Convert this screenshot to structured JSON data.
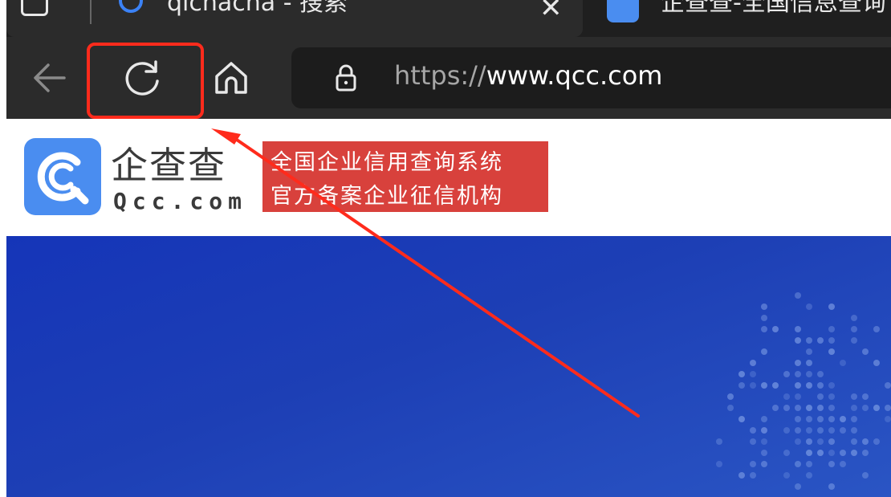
{
  "browser": {
    "active_tab_title": "qichacha - 搜索",
    "second_tab_title": "企查查-全国信息查询",
    "url_scheme": "https://",
    "url_host": "www.qcc.com"
  },
  "site": {
    "logo_cn": "企查查",
    "logo_en": "Qcc.com",
    "badge_line1": "全国企业信用查询系统",
    "badge_line2": "官方备案企业征信机构"
  },
  "colors": {
    "highlight": "#ff2b1c",
    "badge": "#d8413c",
    "hero": "#1d3fb5",
    "logo": "#4a8df0"
  }
}
